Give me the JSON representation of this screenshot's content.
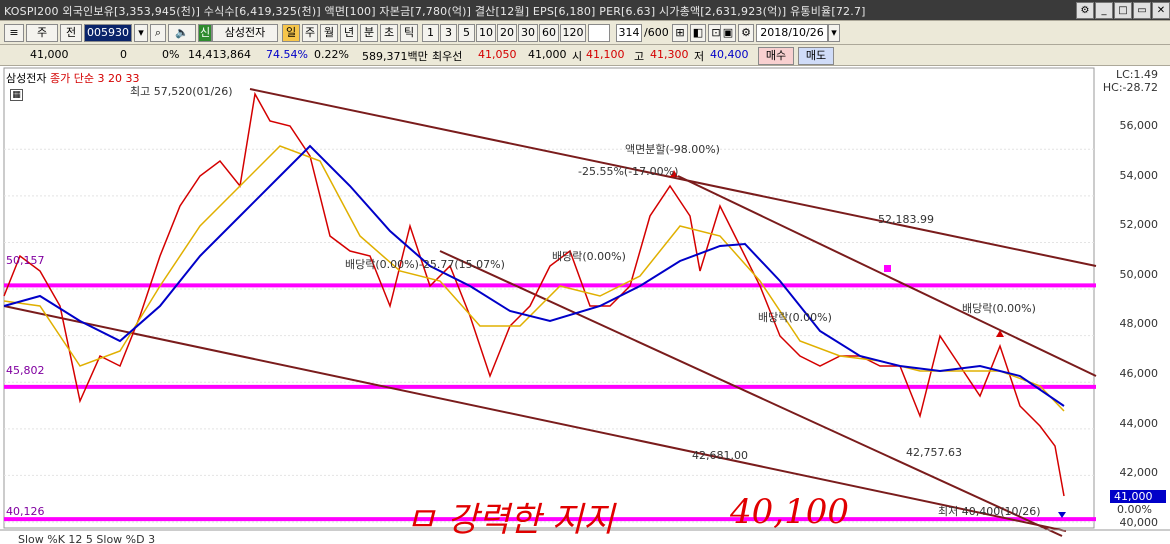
{
  "topbar": {
    "title": "KOSPI200 외국인보유[3,353,945(천)] 수식수[6,419,325(천)] 액면[100] 자본금[7,780(억)] 결산[12월] EPS[6,180] PER[6.63] 시가총액[2,631,923(억)] 유통비율[72.7]"
  },
  "toolbar": {
    "market": "주",
    "prev_label": "전",
    "code": "005930",
    "new_badge": "신",
    "stock_name": "삼성전자",
    "period_day": "일",
    "period_week": "주",
    "period_month": "월",
    "period_year": "년",
    "period_min": "분",
    "period_sec": "초",
    "period_tick": "틱",
    "intervals": [
      "1",
      "3",
      "5",
      "10",
      "20",
      "30",
      "60",
      "120"
    ],
    "count": "314",
    "count_total": "/600",
    "date": "2018/10/26"
  },
  "quote": {
    "price": "41,000",
    "change": "0",
    "change_pct": "0%",
    "volume": "14,413,864",
    "ratio": "74.54%",
    "ratio2": "0.22%",
    "amount": "589,371백만",
    "best_label": "최우선",
    "best_ask": "41,050",
    "best_bid": "41,000",
    "open_label": "시",
    "open": "41,100",
    "high_label": "고",
    "high": "41,300",
    "low_label": "저",
    "low": "40,400",
    "buy": "매수",
    "sell": "매도"
  },
  "chart_data": {
    "type": "line",
    "title": "삼성전자",
    "legend": "종가 단순 3 20 33",
    "legend_colors": {
      "close": "#d40000",
      "ma3": "#e0b000",
      "ma20": "#e0b000",
      "ma33": "#0000c8"
    },
    "ylim": [
      40000,
      57000
    ],
    "y_ticks": [
      "56,000",
      "54,000",
      "52,000",
      "50,000",
      "48,000",
      "46,000",
      "44,000",
      "42,000",
      "40,000"
    ],
    "lc": "LC:1.49",
    "hc": "HC:-28.72",
    "current_price_tag": "41,000",
    "current_pct_tag": "0.00%",
    "horizontal_levels": [
      {
        "label": "50,157",
        "value": 50157
      },
      {
        "label": "45,802",
        "value": 45802
      },
      {
        "label": "40,126",
        "value": 40126
      }
    ],
    "annotations": {
      "high": "최고 57,520(01/26)",
      "split": "액면분할(-98.00%)",
      "split_pct": "-25.55%(-17.00%)",
      "trend_value_1": "52,183.99",
      "div1": "배당락(0.00%)",
      "div1_pct": "배당락(0.00%)-25.77(15.07%)",
      "div2": "배당락(0.00%)",
      "div3": "배당락(0.00%)",
      "div4": "배당락(0.00%)",
      "trend_value_2": "42,681.00",
      "trend_value_3": "42,757.63",
      "low": "최저 40,400(10/26)"
    },
    "handwriting": [
      "ㅁ 강력한 지지",
      "40,100"
    ],
    "indicator_label": "Slow %K 12 5  Slow %D 3"
  },
  "colors": {
    "level_line": "#ff00ff",
    "trend_line": "#7a1c1c",
    "close": "#d40000",
    "ma_fast": "#e0b000",
    "ma_slow": "#0000c8"
  }
}
